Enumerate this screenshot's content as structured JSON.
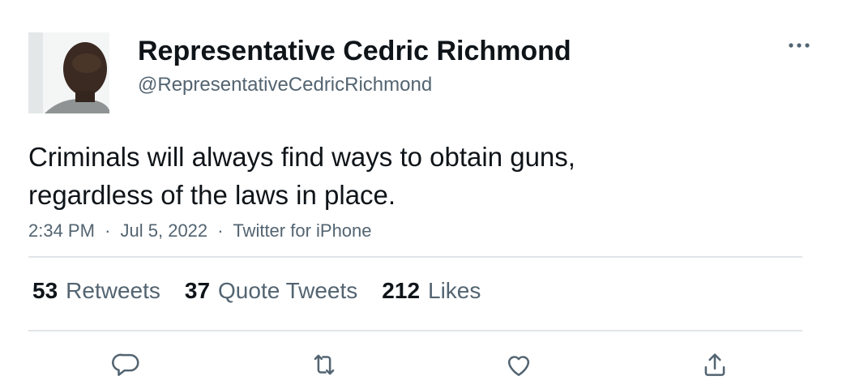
{
  "author": {
    "display_name": "Representative Cedric Richmond",
    "handle": "@RepresentativeCedricRichmond"
  },
  "tweet": {
    "text_line1": "Criminals will always find ways to obtain guns,",
    "text_line2": "regardless of the laws in place."
  },
  "meta": {
    "time": "2:34 PM",
    "separator": "·",
    "date": "Jul 5, 2022",
    "source": "Twitter for iPhone"
  },
  "stats": {
    "retweets_count": "53",
    "retweets_label": "Retweets",
    "quotes_count": "37",
    "quotes_label": "Quote Tweets",
    "likes_count": "212",
    "likes_label": "Likes"
  },
  "icons": {
    "more": "more-icon",
    "reply": "reply-icon",
    "retweet": "retweet-icon",
    "like": "like-icon",
    "share": "share-icon"
  },
  "colors": {
    "text_primary": "#0f1419",
    "text_secondary": "#536471",
    "divider": "#e1e6ea"
  }
}
